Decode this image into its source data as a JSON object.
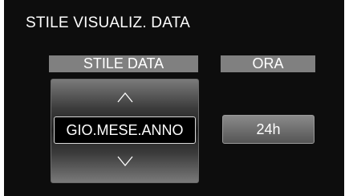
{
  "screen": {
    "title": "STILE VISUALIZ. DATA"
  },
  "date_style": {
    "header": "STILE DATA",
    "value": "GIO.MESE.ANNO",
    "up_icon": "chevron-up-icon",
    "down_icon": "chevron-down-icon"
  },
  "time_style": {
    "header": "ORA",
    "value": "24h"
  },
  "colors": {
    "background": "#0d0d0d",
    "header_bar": "#808080",
    "text": "#ffffff"
  }
}
